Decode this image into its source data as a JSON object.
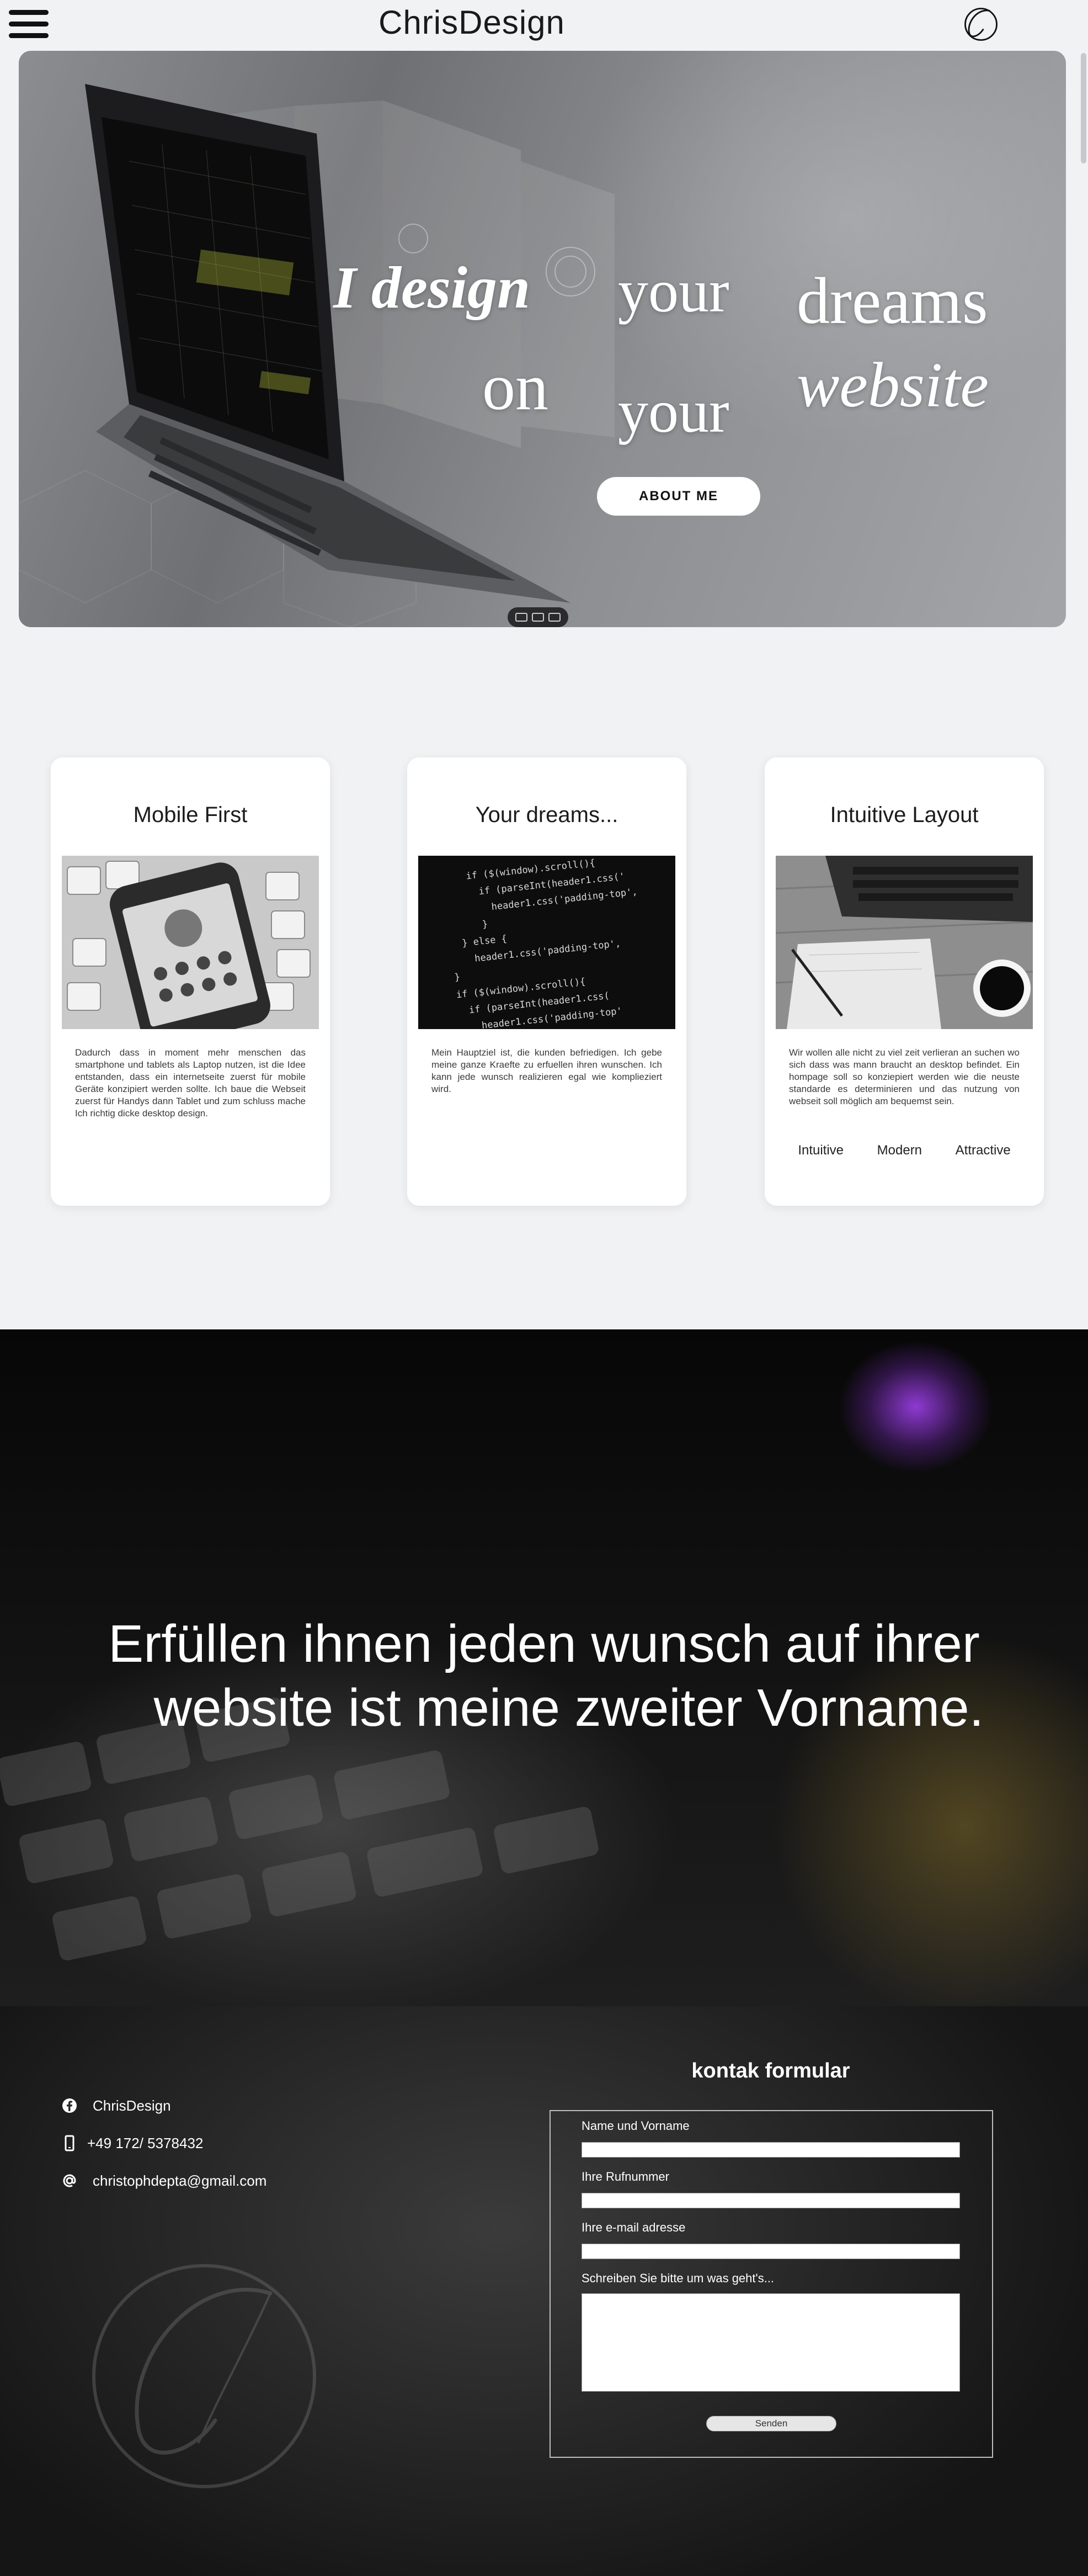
{
  "header": {
    "brand": "ChrisDesign",
    "menu_icon": "hamburger-menu-icon",
    "logo_icon": "signature-c-logo"
  },
  "hero": {
    "line1_word1": "I design",
    "line1_word2": "your",
    "line1_word3": "dreams",
    "line2_word1": "on",
    "line2_word2": "your",
    "line2_word3": "website",
    "button_label": "ABOUT ME",
    "carousel_indicator_count": 3
  },
  "cards": [
    {
      "title": "Mobile First",
      "image": "smartphone-on-keyboard-photo",
      "text": "Dadurch dass in moment mehr menschen das smartphone und tablets als Laptop nutzen, ist die Idee entstanden, dass ein internetseite zuerst für mobile Geräte konzipiert werden sollte. Ich baue die Webseit zuerst für Handys dann Tablet und zum schluss mache Ich richtig dicke desktop design."
    },
    {
      "title": "Your dreams...",
      "image": "code-on-screen-photo",
      "text": "Mein Hauptziel ist, die kunden befriedigen. Ich gebe meine ganze Kraefte zu erfuellen ihren wunschen. Ich kann jede wunsch realizieren egal wie komplieziert wird."
    },
    {
      "title": "Intuitive Layout",
      "image": "laptop-notebook-coffee-photo",
      "text": "Wir wollen alle nicht zu viel zeit verlieran an suchen wo sich dass was mann braucht an desktop befindet. Ein hompage soll so konziepiert werden wie die neuste standarde es determinieren und das nutzung von webseit soll möglich am bequemst sein.",
      "tags": [
        "Intuitive",
        "Modern",
        "Attractive"
      ]
    }
  ],
  "banner": {
    "line1": "Erfüllen ihnen jeden wunsch auf ihrer",
    "line2": "website ist meine zweiter Vorname."
  },
  "footer": {
    "contacts": [
      {
        "icon": "facebook-icon",
        "text": "ChrisDesign"
      },
      {
        "icon": "phone-icon",
        "text": "+49 172/ 5378432"
      },
      {
        "icon": "at-sign-icon",
        "text": "christophdepta@gmail.com"
      }
    ],
    "form": {
      "title": "kontak formular",
      "name_label": "Name und Vorname",
      "phone_label": "Ihre Rufnummer",
      "email_label": "Ihre e-mail adresse",
      "message_label": "Schreiben Sie bitte um was geht's...",
      "submit_label": "Senden"
    }
  },
  "colors": {
    "page_bg": "#f1f2f4",
    "card_bg": "#ffffff",
    "footer_bg": "#2a2a2a",
    "accent_glow": "#8a3ad0"
  }
}
